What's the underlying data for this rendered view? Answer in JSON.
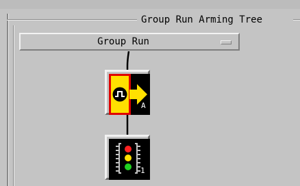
{
  "panel": {
    "title": "Group Run Arming Tree"
  },
  "group_run_button": {
    "label": "Group Run"
  },
  "tree": {
    "nodes": [
      {
        "name": "arming-node",
        "icon": "arming-trigger-icon",
        "label": "A"
      },
      {
        "name": "analyzer-node",
        "icon": "analyzer-module-icon",
        "label": "1"
      }
    ]
  },
  "colors": {
    "background": "#c4c4c4",
    "arming_highlight": "#ffe000",
    "arming_border": "#e00000",
    "led_red": "#ff2020",
    "led_yellow": "#ffe000",
    "led_green": "#20d020"
  }
}
